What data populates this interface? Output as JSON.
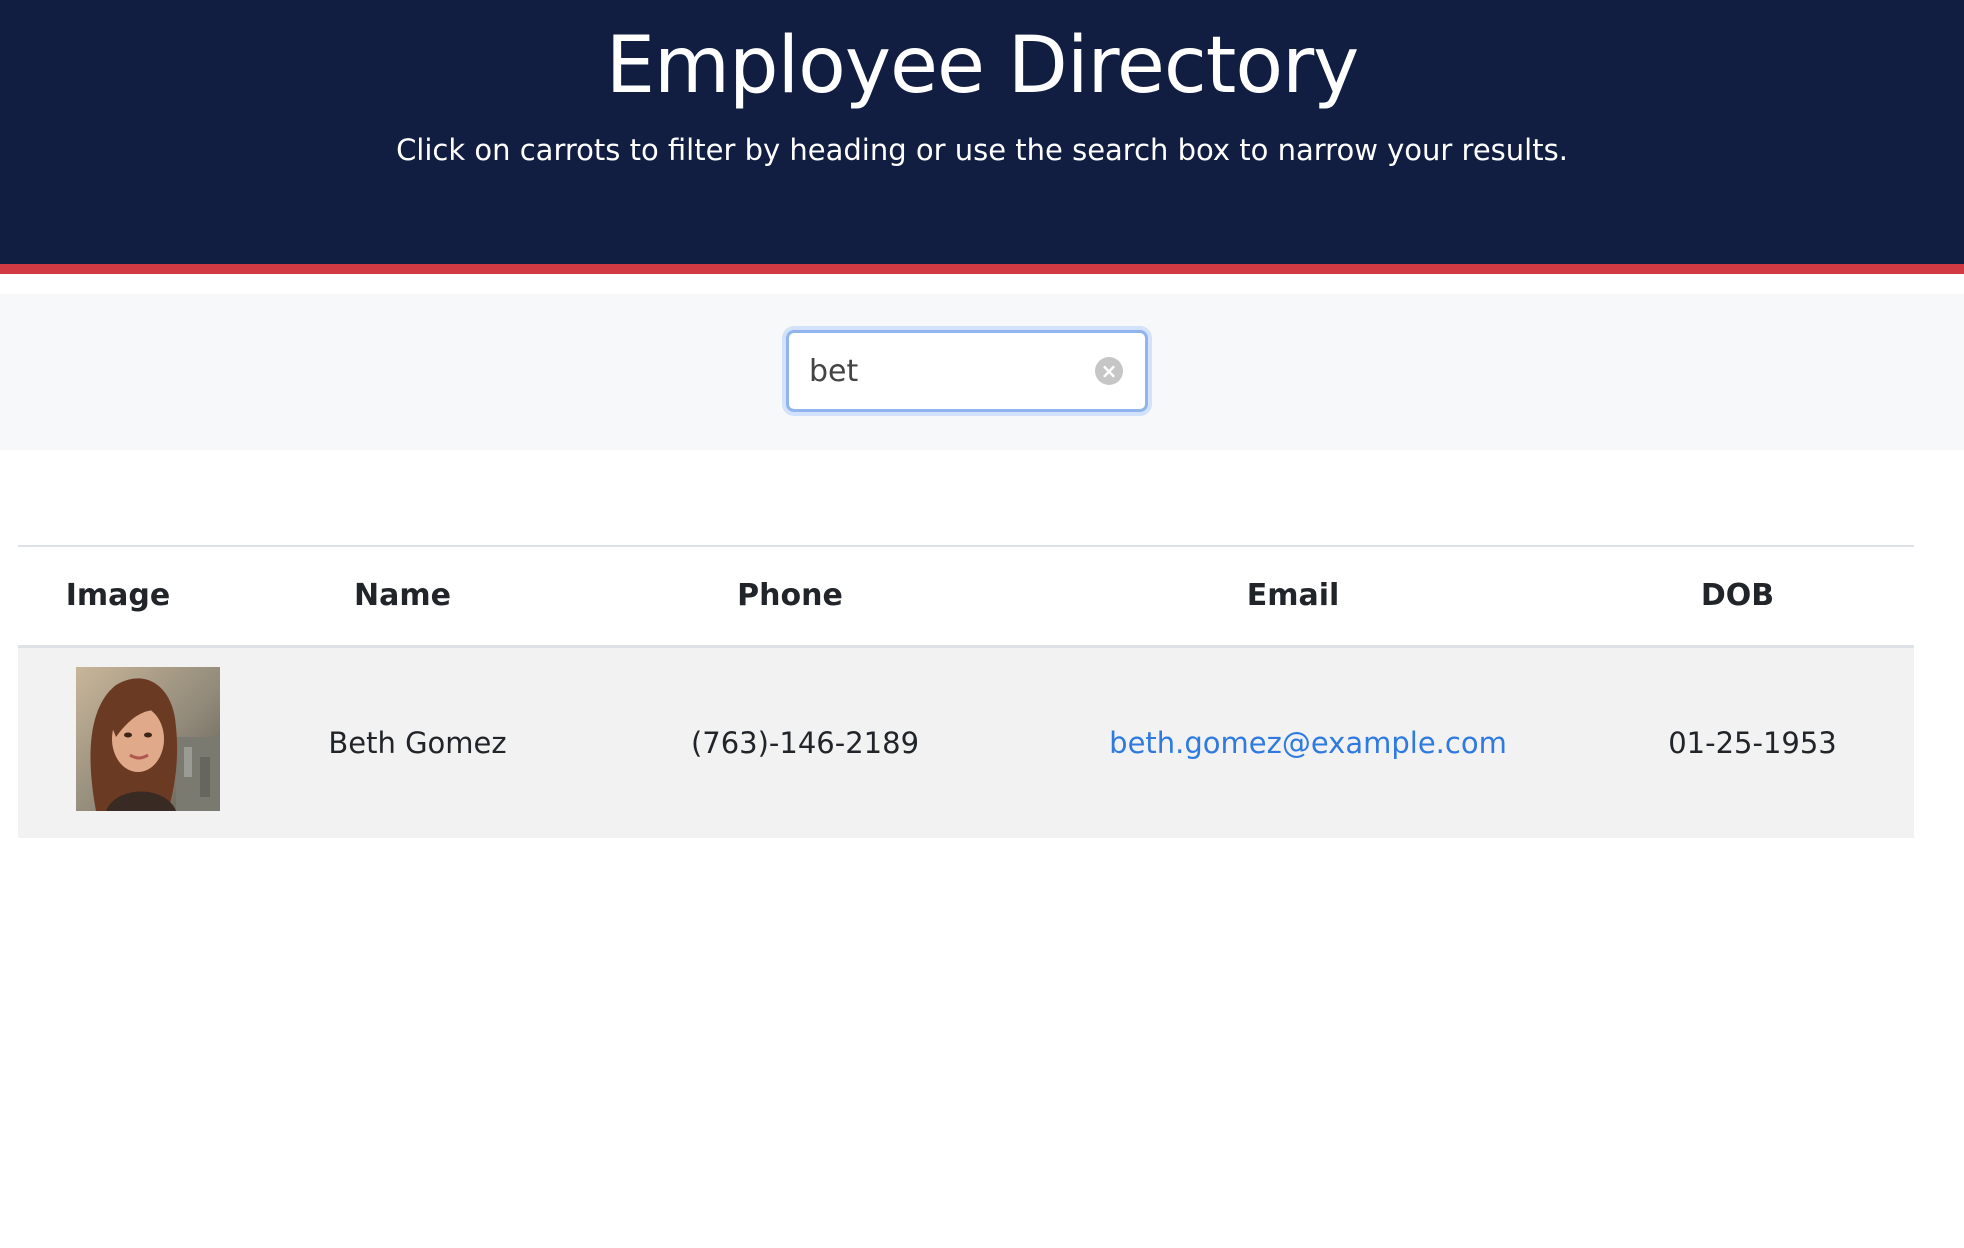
{
  "header": {
    "title": "Employee Directory",
    "subtitle": "Click on carrots to filter by heading or use the search box to narrow your results."
  },
  "search": {
    "value": "bet"
  },
  "table": {
    "columns": [
      "Image",
      "Name",
      "Phone",
      "Email",
      "DOB"
    ],
    "rows": [
      {
        "name": "Beth Gomez",
        "phone": "(763)-146-2189",
        "email": "beth.gomez@example.com",
        "dob": "01-25-1953"
      }
    ]
  },
  "colors": {
    "header_bg": "#121e41",
    "accent_stripe": "#d23a43",
    "link": "#2f7ae0"
  },
  "icons": {
    "clear": "clear-icon",
    "avatar": "avatar"
  }
}
